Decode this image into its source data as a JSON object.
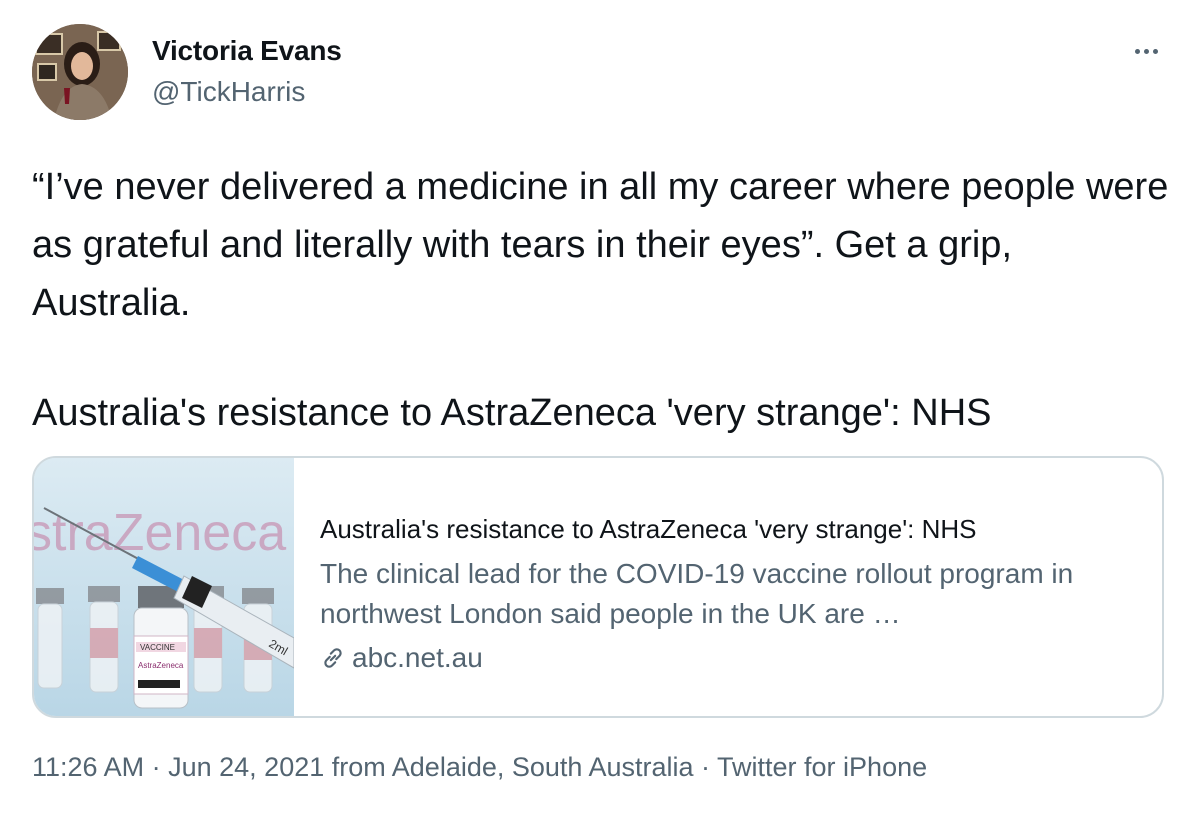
{
  "author": {
    "display_name": "Victoria Evans",
    "handle": "@TickHarris"
  },
  "more_icon": "more-horizontal-icon",
  "tweet": {
    "text_para1": "“I’ve never delivered a medicine in all my career where people were as grateful and literally with tears in their eyes”. Get a grip, Australia.",
    "text_para2": "Australia's resistance to AstraZeneca 'very strange': NHS"
  },
  "card": {
    "title": "Australia's resistance to AstraZeneca 'very strange': NHS",
    "description": "The clinical lead for the COVID-19 vaccine rollout program in northwest London said people in the UK are …",
    "domain": "abc.net.au",
    "link_icon": "link-icon",
    "thumb_logo_text": "straZeneca",
    "thumb_vial_label": "VACCINE",
    "thumb_vial_brand": "AstraZeneca",
    "thumb_syringe_text": "2ml"
  },
  "meta": {
    "time": "11:26 AM",
    "separator1": "·",
    "date": "Jun 24, 2021",
    "from_text": "from",
    "location": "Adelaide, South Australia",
    "separator2": "·",
    "source": "Twitter for iPhone"
  },
  "colors": {
    "text_primary": "#0f1419",
    "text_secondary": "#536471",
    "border": "#cfd9de"
  }
}
